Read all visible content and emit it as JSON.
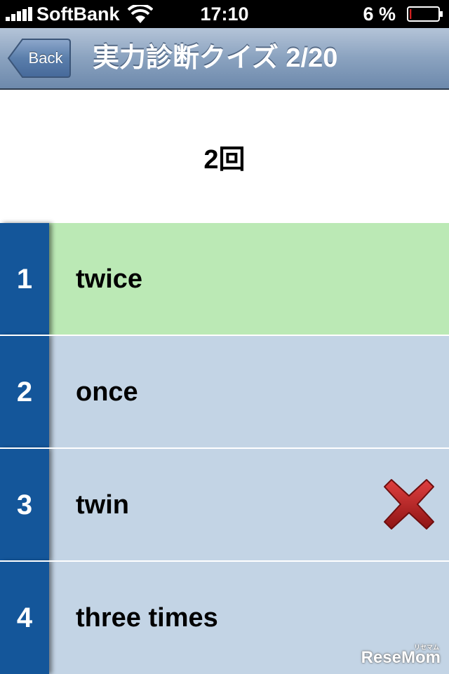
{
  "status_bar": {
    "carrier": "SoftBank",
    "time": "17:10",
    "battery_percent": "6 %",
    "battery_level": 0.06,
    "battery_color": "#d02020"
  },
  "nav": {
    "back_label": "Back",
    "title": "実力診断クイズ 2/20"
  },
  "question": "2回",
  "answers": [
    {
      "number": "1",
      "text": "twice",
      "state": "correct",
      "bg": "#bbe9b5"
    },
    {
      "number": "2",
      "text": "once",
      "state": "neutral",
      "bg": "#c3d4e5"
    },
    {
      "number": "3",
      "text": "twin",
      "state": "wrong",
      "bg": "#c3d4e5",
      "icon": "wrong-x-icon"
    },
    {
      "number": "4",
      "text": "three times",
      "state": "neutral",
      "bg": "#c3d4e5"
    }
  ],
  "colors": {
    "number_column": "#14569a",
    "correct": "#bbe9b5",
    "neutral": "#c3d4e5",
    "wrong_icon": "#c42222"
  },
  "watermark": "ReseMom",
  "watermark_sub": "リセマム"
}
